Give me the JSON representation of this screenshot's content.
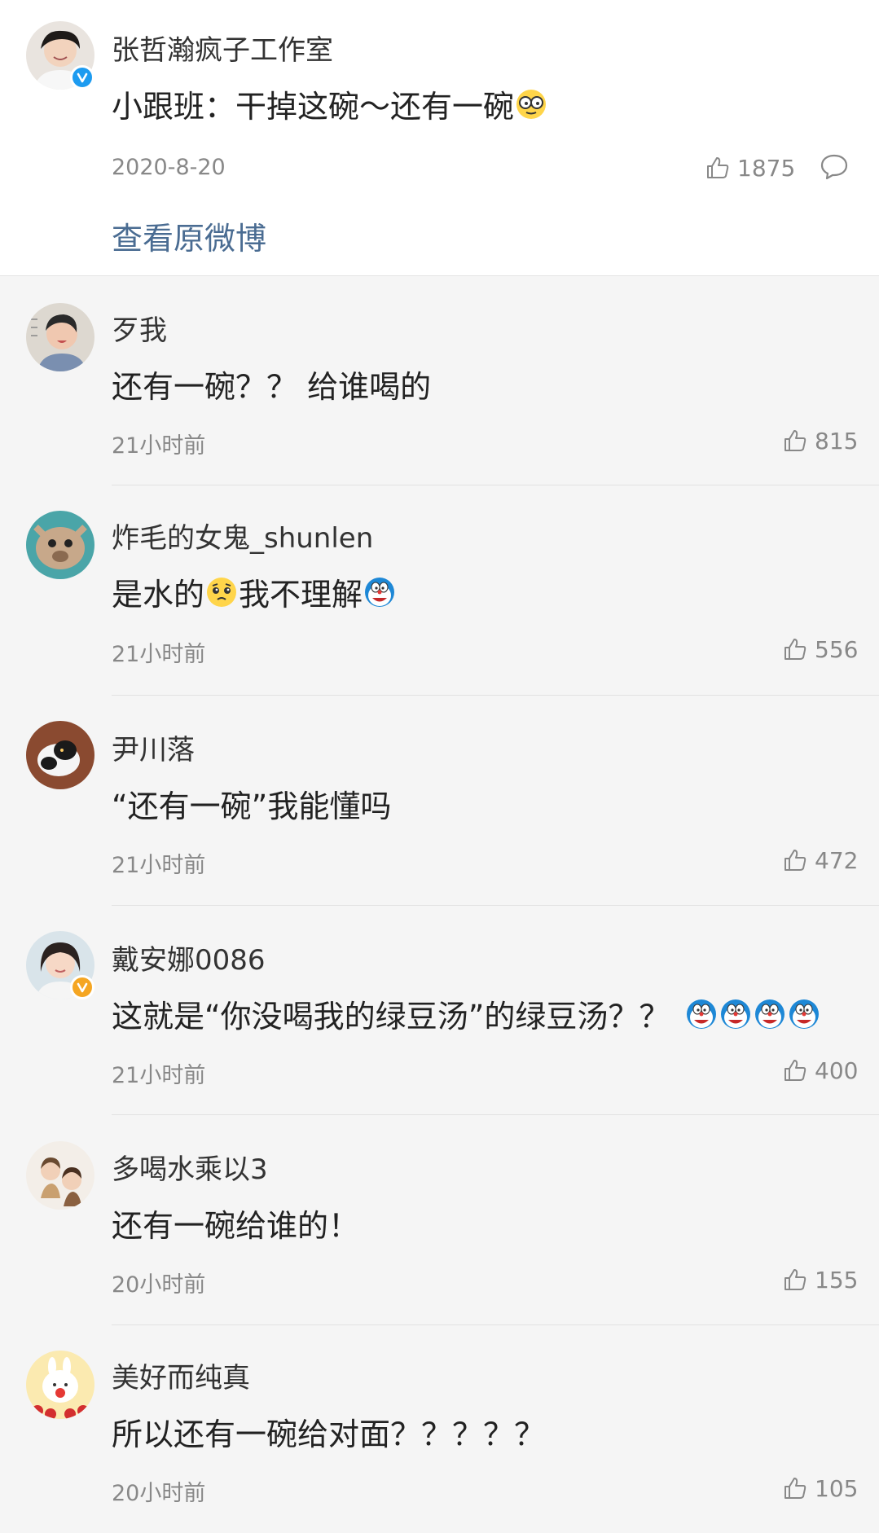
{
  "root": {
    "username": "张哲瀚疯子工作室",
    "text": "小跟班：干掉这碗～还有一碗",
    "date": "2020-8-20",
    "likes": "1875",
    "view_original": "查看原微博",
    "emoji": "cool-glasses-emoji"
  },
  "comments": [
    {
      "username": "歹我",
      "text": "还有一碗？？ 给谁喝的",
      "time": "21小时前",
      "likes": "815"
    },
    {
      "username": "炸毛的女鬼_shunlen",
      "text_parts": [
        "是水的",
        "我不理解"
      ],
      "emojis": [
        "pleading-face-emoji",
        "doraemon-emoji"
      ],
      "time": "21小时前",
      "likes": "556"
    },
    {
      "username": "尹川落",
      "text": "“还有一碗”我能懂吗",
      "time": "21小时前",
      "likes": "472"
    },
    {
      "username": "戴安娜0086",
      "text": "这就是“你没喝我的绿豆汤”的绿豆汤？？",
      "emojis": [
        "doraemon-emoji",
        "doraemon-emoji",
        "doraemon-emoji",
        "doraemon-emoji"
      ],
      "time": "21小时前",
      "likes": "400"
    },
    {
      "username": "多喝水乘以3",
      "text": "还有一碗给谁的！",
      "time": "20小时前",
      "likes": "155"
    },
    {
      "username": "美好而纯真",
      "text": "所以还有一碗给对面？？？？？",
      "time": "20小时前",
      "likes": "105"
    }
  ],
  "colors": {
    "link": "#4a6c92",
    "verified_blue": "#1d9bf0",
    "verified_gold": "#f5a623",
    "meta": "#888888",
    "background": "#f5f5f5"
  }
}
